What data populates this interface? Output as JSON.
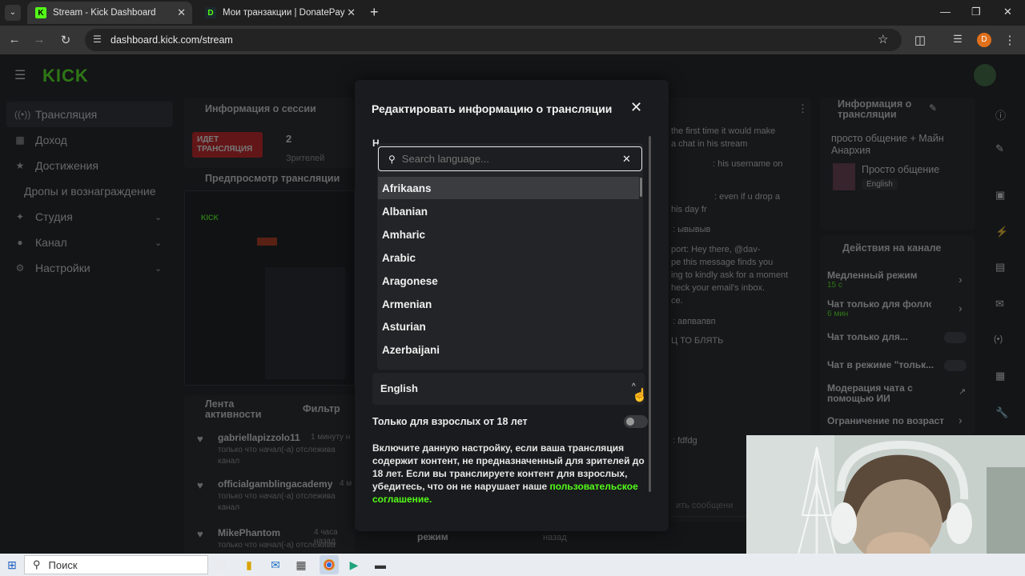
{
  "browser": {
    "tabs": [
      {
        "title": "Stream - Kick Dashboard",
        "favicon": "K",
        "active": true
      },
      {
        "title": "Мои транзакции | DonatePay",
        "favicon": "D",
        "active": false
      }
    ],
    "url": "dashboard.kick.com/stream",
    "profile_initial": "D"
  },
  "sidebar": {
    "logo": "KICK",
    "items": [
      {
        "label": "Трансляция",
        "icon": "broadcast-icon"
      },
      {
        "label": "Доход",
        "icon": "wallet-icon"
      },
      {
        "label": "Достижения",
        "icon": "trophy-icon"
      },
      {
        "label": "Дропы и вознаграждение",
        "icon": ""
      },
      {
        "label": "Студия",
        "icon": "studio-icon"
      },
      {
        "label": "Канал",
        "icon": "users-icon"
      },
      {
        "label": "Настройки",
        "icon": "gear-icon"
      }
    ]
  },
  "background": {
    "session_title": "Информация о сессии",
    "live_badge": "ИДЕТ ТРАНСЛЯЦИЯ",
    "viewers_count": "2",
    "viewers_label": "Зрителей",
    "preview_title": "Предпросмотр трансляции",
    "activity_title": "Лента активности",
    "activity_filter": "Фильтр",
    "activity": [
      {
        "user": "gabriellapizzolo11",
        "time": "1 минуту н",
        "text": "только что начал(-а) отслежива канал"
      },
      {
        "user": "officialgamblingacademy",
        "time": "4 м",
        "text": "только что начал(-а) отслежива канал"
      },
      {
        "user": "MikePhantom",
        "time": "4 часа назад",
        "text": "только что начал(-а) отслежива"
      }
    ],
    "chat_lines": [
      "the first time it would make",
      "a chat in his stream",
      ": his username on",
      ": even if u drop a",
      "his day fr",
      ": ывывыв",
      "port: Hey there, @dav-",
      "pe this message finds you",
      "ing to kindly ask for a moment",
      "heck your email's inbox.",
      "ce.",
      ": авпвапвп",
      "Ц ТО БЛЯТЬ",
      ": fdfdg"
    ],
    "chat_input_placeholder": "ить сообщени",
    "mode_label": "режим",
    "mode_time": "назад",
    "info_title": "Информация о трансляции",
    "stream_title": "просто общение + Майн Анархия",
    "category": "Просто общение",
    "language_tag": "English",
    "actions_title": "Действия на канале",
    "actions": [
      {
        "label": "Медленный режим",
        "sub": "15 с",
        "control": "chevron"
      },
      {
        "label": "Чат только для фолловер",
        "sub": "6 мин",
        "control": "chevron"
      },
      {
        "label": "Чат только для...",
        "sub": "",
        "control": "toggle"
      },
      {
        "label": "Чат в режиме \"тольк...",
        "sub": "",
        "control": "toggle"
      },
      {
        "label": "Модерация чата с помощью ИИ",
        "sub": "",
        "control": "external"
      },
      {
        "label": "Ограничение по возраст",
        "sub": "",
        "control": "chevron"
      }
    ]
  },
  "modal": {
    "title": "Редактировать информацию о трансляции",
    "partial_label": "Н",
    "search_placeholder": "Search language...",
    "languages": [
      "Afrikaans",
      "Albanian",
      "Amharic",
      "Arabic",
      "Aragonese",
      "Armenian",
      "Asturian",
      "Azerbaijani"
    ],
    "highlighted_index": 0,
    "selected_language": "English",
    "adult_label": "Только для взрослых от 18 лет",
    "adult_enabled": false,
    "description": "Включите данную настройку, если ваша трансляция содержит контент, не предназначенный для зрителей до 18 лет. Если вы транслируете контент для взрослых, убедитесь, что он не нарушает наше",
    "agreement_link": "пользовательское соглашение",
    "agreement_suffix": "."
  },
  "taskbar": {
    "search_placeholder": "Поиск"
  },
  "colors": {
    "kick_green": "#53fc18",
    "modal_bg": "#1a1b1e",
    "highlight": "#3b3c40"
  }
}
